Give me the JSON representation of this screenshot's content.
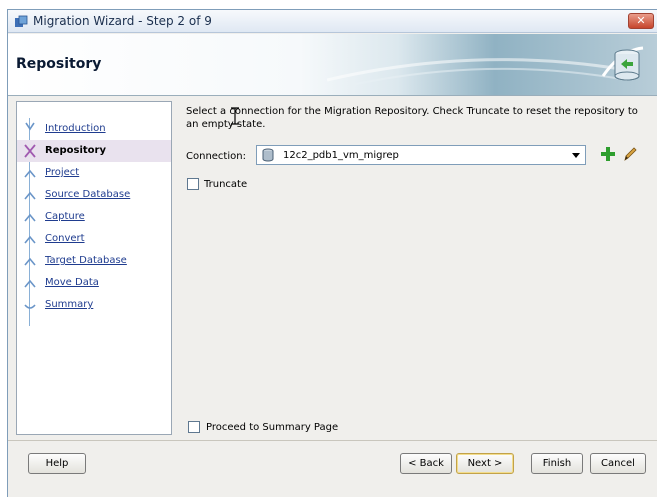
{
  "window": {
    "title": "Migration Wizard - Step 2 of 9",
    "close_label": "✕"
  },
  "banner": {
    "title": "Repository"
  },
  "nav": {
    "items": [
      {
        "label": "Introduction",
        "current": false
      },
      {
        "label": "Repository",
        "current": true
      },
      {
        "label": "Project",
        "current": false
      },
      {
        "label": "Source Database",
        "current": false
      },
      {
        "label": "Capture",
        "current": false
      },
      {
        "label": "Convert",
        "current": false
      },
      {
        "label": "Target Database",
        "current": false
      },
      {
        "label": "Move Data",
        "current": false
      },
      {
        "label": "Summary",
        "current": false
      }
    ]
  },
  "content": {
    "instructions": "Select a connection for the Migration Repository.  Check Truncate to reset the repository to an empty state.",
    "connection_label": "Connection:",
    "connection_value": "12c2_pdb1_vm_migrep",
    "truncate_label": "Truncate",
    "truncate_checked": false,
    "proceed_label": "Proceed to Summary Page",
    "proceed_checked": false
  },
  "footer": {
    "help": "Help",
    "back": "< Back",
    "next": "Next >",
    "finish": "Finish",
    "cancel": "Cancel"
  },
  "colors": {
    "link": "#1f3c8f",
    "selected_row": "#e9e2ee",
    "add_icon": "#2e9e2e"
  }
}
